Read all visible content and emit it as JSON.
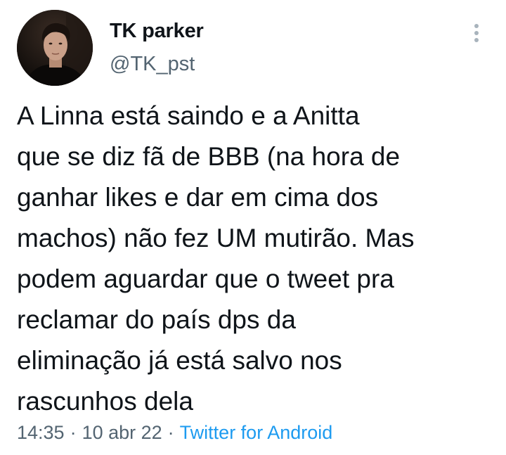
{
  "tweet": {
    "author": {
      "display_name": "TK parker",
      "handle": "@TK_pst",
      "avatar_icon": "profile-photo"
    },
    "more_icon": "more-vertical-icon",
    "text": "A Linna está saindo e a Anitta\nque se diz fã de BBB (na hora de\nganhar likes e dar em cima dos\nmachos) não fez UM mutirão. Mas\npodem aguardar que o tweet pra\nreclamar do país dps da\neliminação já está salvo nos\nrascunhos dela",
    "time": "14:35",
    "date": "10 abr 22",
    "separator": "·",
    "source": "Twitter for Android"
  },
  "colors": {
    "text_primary": "#0f1419",
    "text_secondary": "#536471",
    "link": "#1d9bf0",
    "background": "#ffffff"
  }
}
